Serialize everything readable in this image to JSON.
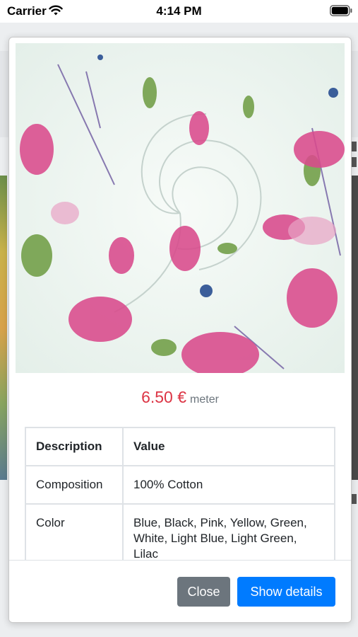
{
  "status_bar": {
    "carrier": "Carrier",
    "time": "4:14 PM",
    "wifi_icon": "wifi-icon",
    "battery_icon": "battery-icon"
  },
  "modal": {
    "image_description_icon": "fabric-image",
    "price": {
      "value": "6.50 €",
      "unit": "meter",
      "color": "#dc3545"
    },
    "table": {
      "headers": [
        "Description",
        "Value"
      ],
      "rows": [
        {
          "description": "Composition",
          "value": "100% Cotton"
        },
        {
          "description": "Color",
          "value": "Blue, Black, Pink, Yellow, Green, White, Light Blue, Light Green, Lilac"
        }
      ]
    },
    "buttons": {
      "close_label": "Close",
      "details_label": "Show details",
      "close_color": "#6c757d",
      "details_color": "#007bff"
    }
  }
}
